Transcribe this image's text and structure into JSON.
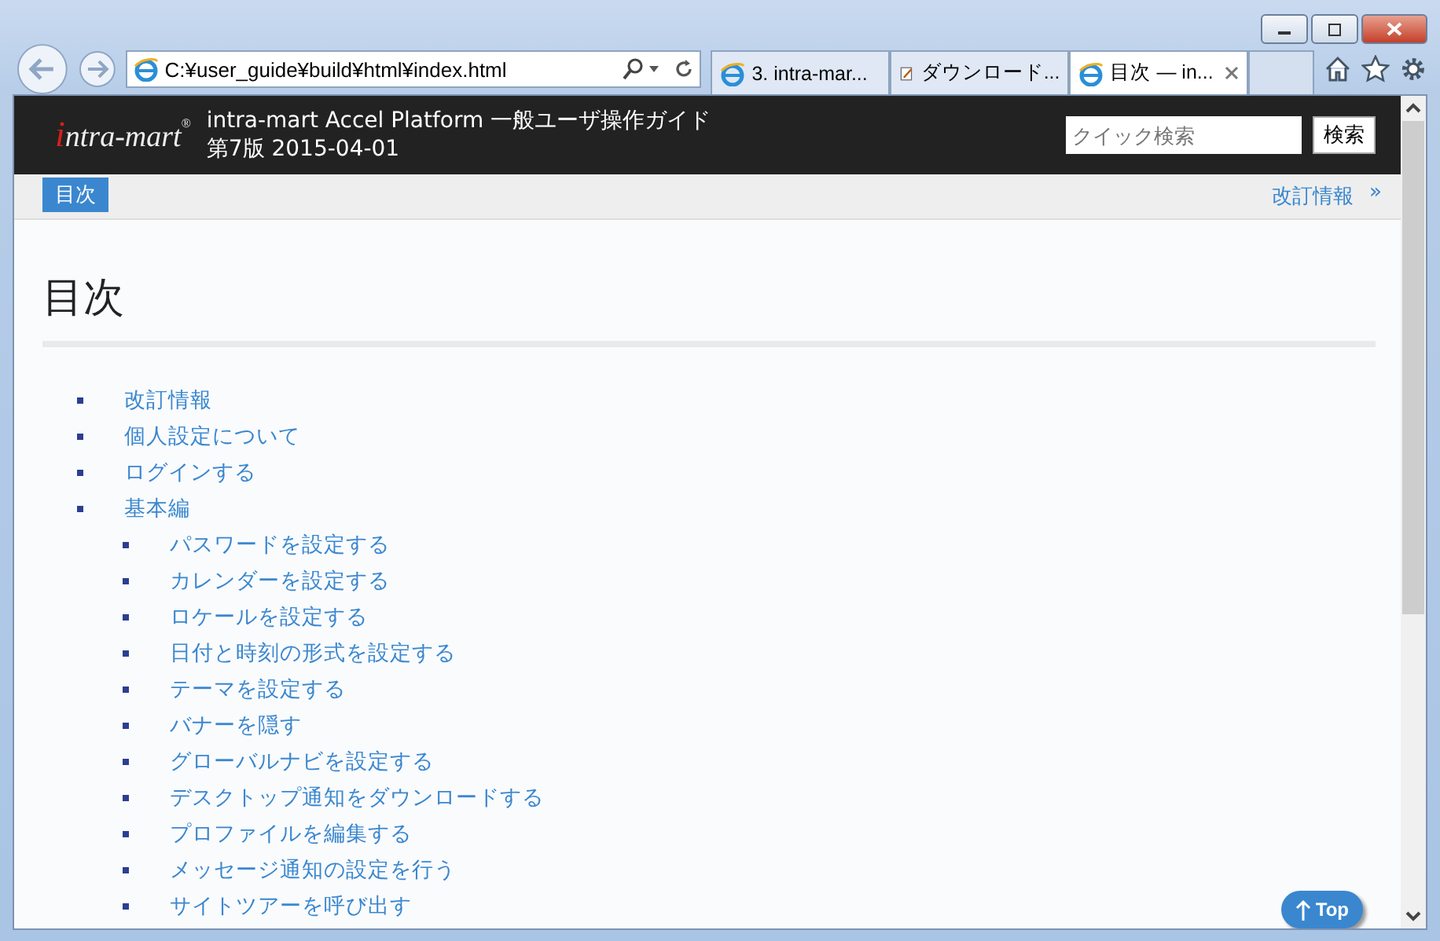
{
  "browser": {
    "address": "C:¥user_guide¥build¥html¥index.html",
    "tabs": [
      {
        "label": "3. intra-mar...",
        "selected": false,
        "kind": "ie"
      },
      {
        "label": "ダウンロード...",
        "selected": false,
        "kind": "doc"
      },
      {
        "label": "目次 — in...",
        "selected": true,
        "kind": "ie"
      }
    ]
  },
  "header": {
    "logo": "intra-mart",
    "logo_mark": "®",
    "title": "intra-mart Accel Platform 一般ユーザ操作ガイド",
    "edition": "第7版 2015-04-01",
    "search": {
      "placeholder": "クイック検索"
    },
    "search_button": "検索"
  },
  "nav": {
    "current": "目次",
    "next": "改訂情報",
    "next_mark": "»"
  },
  "page": {
    "heading": "目次",
    "toc": [
      {
        "label": "改訂情報"
      },
      {
        "label": "個人設定について"
      },
      {
        "label": "ログインする"
      },
      {
        "label": "基本編",
        "children": [
          {
            "label": "パスワードを設定する"
          },
          {
            "label": "カレンダーを設定する"
          },
          {
            "label": "ロケールを設定する"
          },
          {
            "label": "日付と時刻の形式を設定する"
          },
          {
            "label": "テーマを設定する"
          },
          {
            "label": "バナーを隠す"
          },
          {
            "label": "グローバルナビを設定する"
          },
          {
            "label": "デスクトップ通知をダウンロードする"
          },
          {
            "label": "プロファイルを編集する"
          },
          {
            "label": "メッセージ通知の設定を行う"
          },
          {
            "label": "サイトツアーを呼び出す"
          }
        ]
      }
    ],
    "top_button": "Top"
  }
}
